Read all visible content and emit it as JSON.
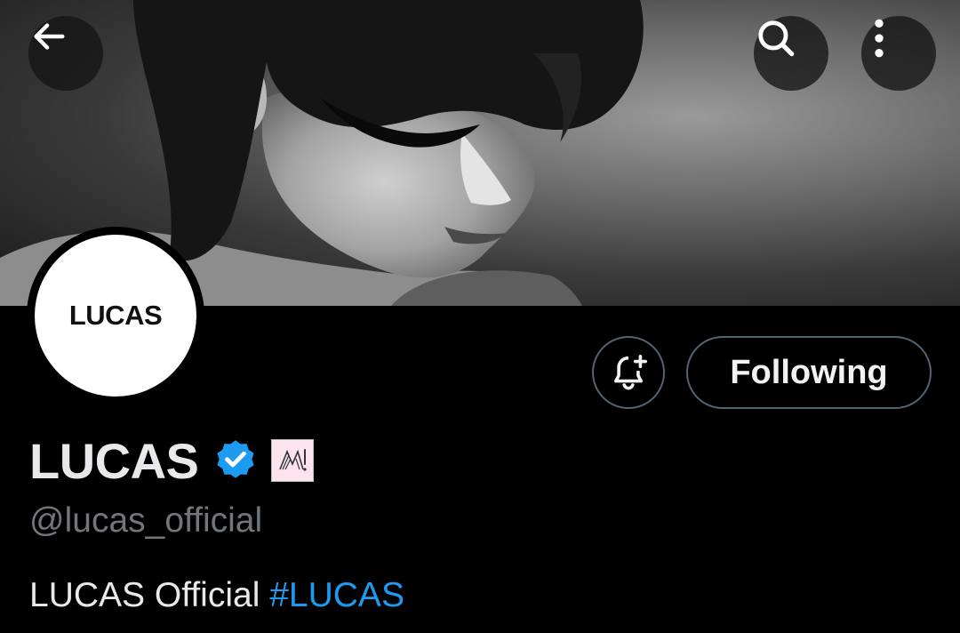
{
  "header": {
    "back_icon": "arrow-left-icon",
    "search_icon": "search-icon",
    "more_icon": "more-vertical-icon"
  },
  "profile": {
    "avatar_text": "LUCAS",
    "name": "LUCAS",
    "verified_icon": "verified-badge-icon",
    "verified_color": "#1d9bf0",
    "affiliate_badge_icon": "affiliate-label-icon",
    "handle": "@lucas_official",
    "bio_text": "LUCAS Official",
    "bio_hashtag": "#LUCAS",
    "hashtag_color": "#1d9bf0"
  },
  "actions": {
    "notify_icon": "bell-plus-icon",
    "follow_label": "Following"
  }
}
